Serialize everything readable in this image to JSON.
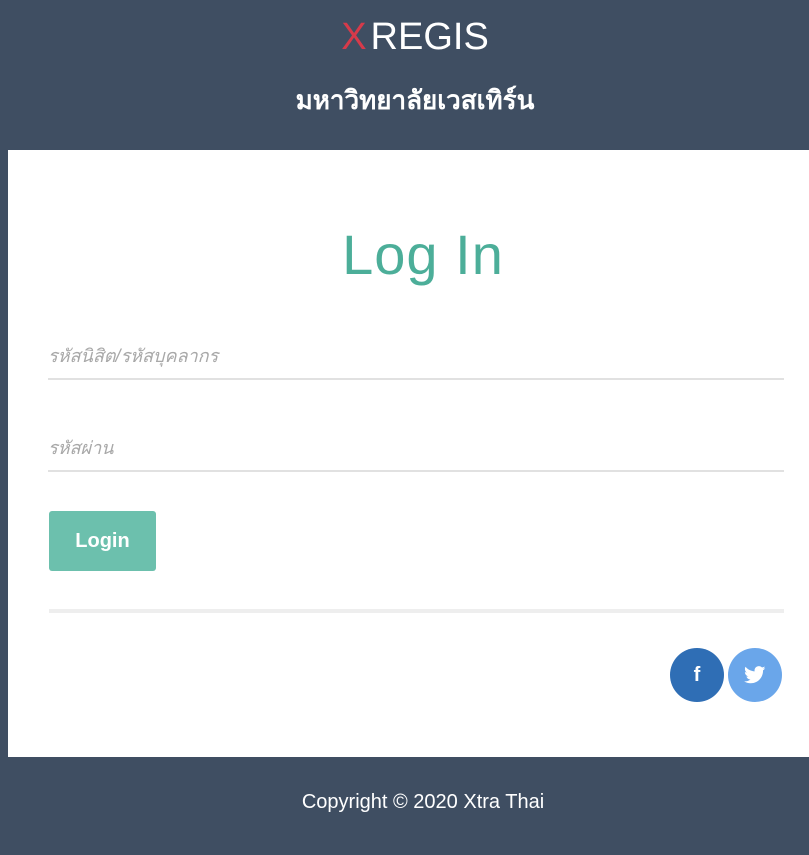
{
  "header": {
    "brand_x": "X",
    "brand_name": "REGIS",
    "university": "มหาวิทยาลัยเวสเทิร์น"
  },
  "login": {
    "title": "Log In",
    "username_placeholder": "รหัสนิสิต/รหัสบุคลากร",
    "password_placeholder": "รหัสผ่าน",
    "button_label": "Login"
  },
  "social": {
    "facebook_label": "f",
    "icons": [
      "facebook-icon",
      "twitter-icon"
    ],
    "facebook_color": "#2f6eb5",
    "twitter_color": "#6aa6ea"
  },
  "footer": {
    "copyright": "Copyright © 2020 Xtra Thai"
  },
  "colors": {
    "header_bg": "#3f4e62",
    "brand_accent": "#d63a4a",
    "title_color": "#4cae99",
    "button_bg": "#6cc0ad"
  }
}
